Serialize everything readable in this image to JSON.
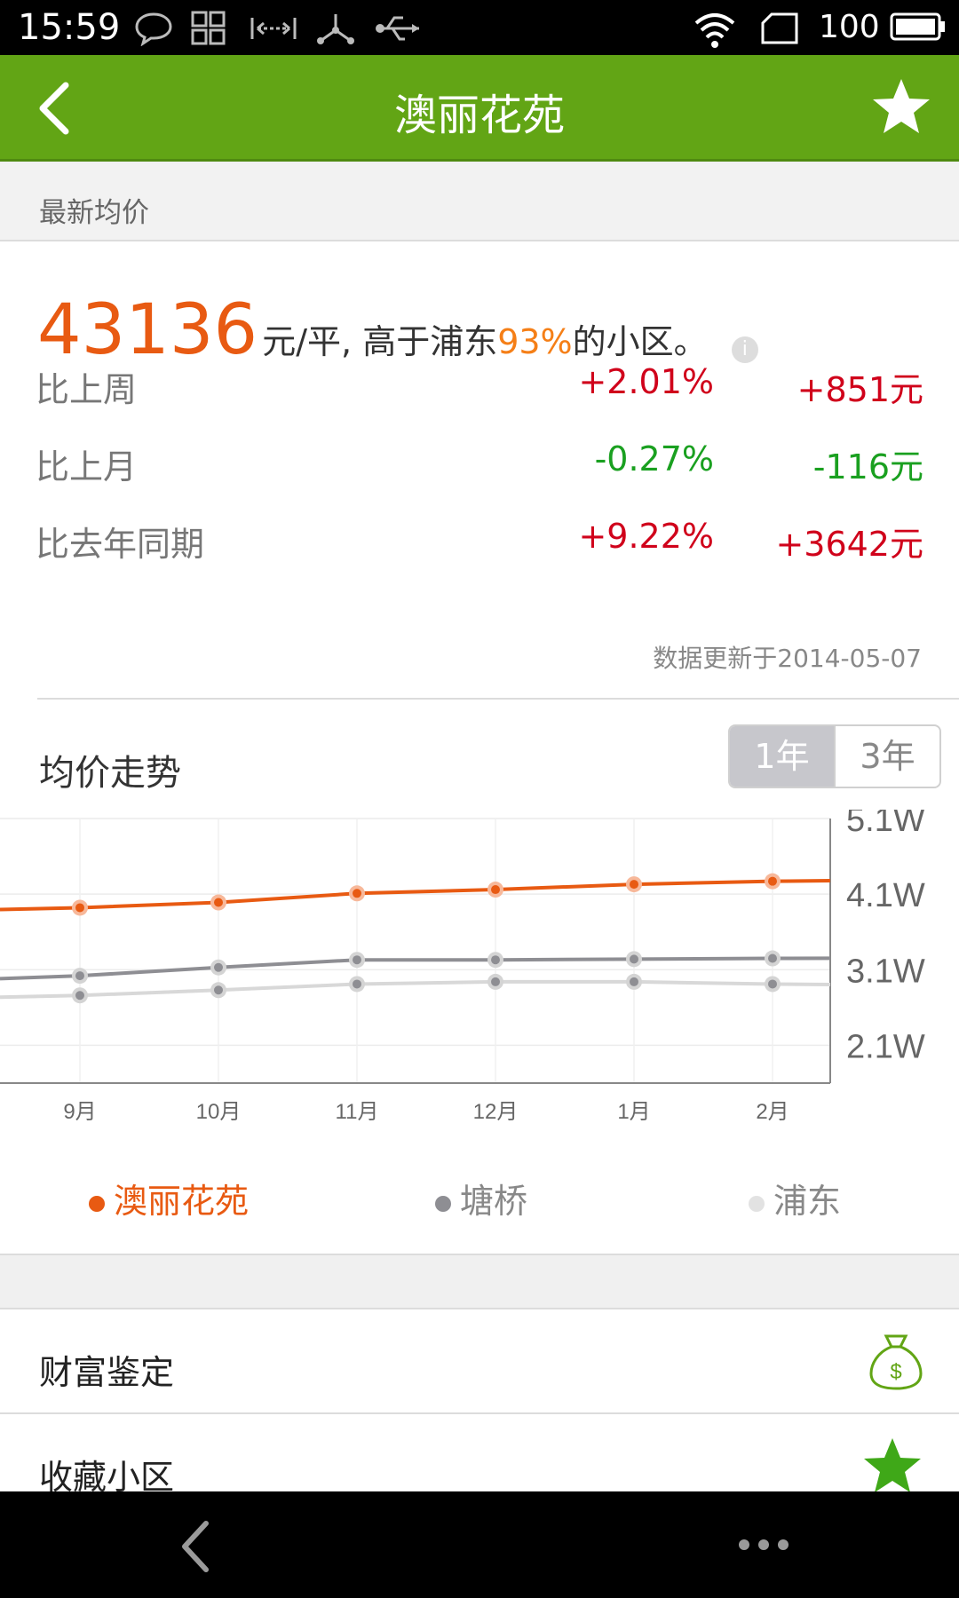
{
  "status_bar": {
    "time": "15:59",
    "battery": "100"
  },
  "header": {
    "title": "澳丽花苑",
    "back_icon": "back-arrow-icon",
    "favorite_icon": "star-icon"
  },
  "section": {
    "title": "最新均价"
  },
  "price": {
    "value": "43136",
    "unit_text": "元/平, 高于浦东",
    "percent": "93%",
    "suffix": "的小区。",
    "info_icon": "i"
  },
  "comparisons": [
    {
      "label": "比上周",
      "pct": "+2.01%",
      "amount": "+851元",
      "trend": "up"
    },
    {
      "label": "比上月",
      "pct": "-0.27%",
      "amount": "-116元",
      "trend": "down"
    },
    {
      "label": "比去年同期",
      "pct": "+9.22%",
      "amount": "+3642元",
      "trend": "up"
    }
  ],
  "update_text": "数据更新于2014-05-07",
  "trend": {
    "title": "均价走势",
    "ranges": [
      "1年",
      "3年"
    ],
    "selected_range": "1年"
  },
  "colors": {
    "accent": "#62a515",
    "primary_series": "#e85a12",
    "second_series": "#8e8e93",
    "third_series": "#d8d8d8",
    "up": "#d0021b",
    "down": "#1aa020"
  },
  "chart_data": {
    "type": "line",
    "categories": [
      "9月",
      "10月",
      "11月",
      "12月",
      "1月",
      "2月"
    ],
    "y_ticks": [
      "5.1W",
      "4.1W",
      "3.1W",
      "2.1W"
    ],
    "ylim": [
      16000,
      51000
    ],
    "legend_position": "bottom",
    "series": [
      {
        "name": "澳丽花苑",
        "values": [
          39200,
          39900,
          41100,
          41600,
          42300,
          42700
        ]
      },
      {
        "name": "塘桥",
        "values": [
          30200,
          31300,
          32300,
          32300,
          32400,
          32500
        ]
      },
      {
        "name": "浦东",
        "values": [
          27600,
          28300,
          29100,
          29400,
          29400,
          29100
        ]
      }
    ]
  },
  "menu": [
    {
      "label": "财富鉴定",
      "icon": "money-bag-icon"
    },
    {
      "label": "收藏小区",
      "icon": "star-icon"
    }
  ]
}
